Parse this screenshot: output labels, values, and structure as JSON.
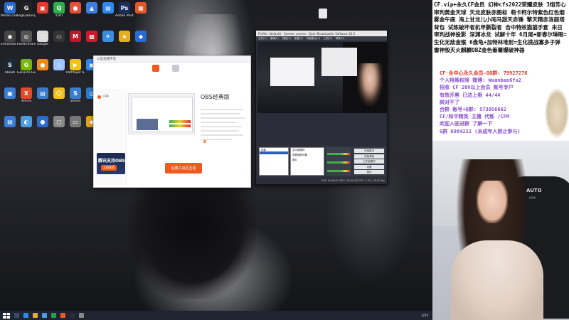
{
  "desktop": {
    "icons": [
      {
        "label": "Weibo.com maxiny...",
        "color": "#2a6ad1",
        "glyph": "W"
      },
      {
        "label": "LogiGaming Hub",
        "color": "#222222",
        "glyph": "G"
      },
      {
        "label": "",
        "color": "#e23b2a",
        "glyph": "▣"
      },
      {
        "label": "iQIYI",
        "color": "#2bb24c",
        "glyph": "Q"
      },
      {
        "label": "",
        "color": "#e94f3a",
        "glyph": "●"
      },
      {
        "label": "",
        "color": "#3b7de0",
        "glyph": "▲"
      },
      {
        "label": "",
        "color": "#2d89ef",
        "glyph": "▤"
      },
      {
        "label": "Adobe Photosho...",
        "color": "#1b2d5c",
        "glyph": "Ps"
      },
      {
        "label": "",
        "color": "#e0572a",
        "glyph": "▦"
      },
      {
        "label": "Elmanhar...",
        "color": "#444444",
        "glyph": "◉"
      },
      {
        "label": "PureEntrance",
        "color": "#555555",
        "glyph": "◎"
      },
      {
        "label": "Google",
        "color": "#dddddd",
        "glyph": "▢"
      },
      {
        "label": "",
        "color": "#333333",
        "glyph": "▭"
      },
      {
        "label": "",
        "color": "#c0182a",
        "glyph": "M"
      },
      {
        "label": "",
        "color": "#d0182a",
        "glyph": "▩"
      },
      {
        "label": "",
        "color": "#3a8de0",
        "glyph": "✈"
      },
      {
        "label": "",
        "color": "#e0b020",
        "glyph": "★"
      },
      {
        "label": "",
        "color": "#2a6ad1",
        "glyph": "◆"
      },
      {
        "label": "Steam",
        "color": "#1b2838",
        "glyph": "S"
      },
      {
        "label": "GeForce Experience",
        "color": "#76b900",
        "glyph": "G"
      },
      {
        "label": "",
        "color": "#ee8a1f",
        "glyph": "●"
      },
      {
        "label": "",
        "color": "#a0c4ff",
        "glyph": "◇"
      },
      {
        "label": "PotPlayer 64 bit",
        "color": "#f1c40f",
        "glyph": "▶"
      },
      {
        "label": "",
        "color": "#2d89ef",
        "glyph": "▣"
      },
      {
        "label": "",
        "color": "#1aa34a",
        "glyph": "◐"
      },
      {
        "label": "Pr",
        "color": "#2a1f5c",
        "glyph": "Pr"
      },
      {
        "label": "",
        "color": "#1aa34a",
        "glyph": "●"
      },
      {
        "label": "",
        "color": "#3a7dd0",
        "glyph": "▣"
      },
      {
        "label": "Xmind",
        "color": "#e24a2a",
        "glyph": "X"
      },
      {
        "label": "",
        "color": "#3a7dd0",
        "glyph": "▤"
      },
      {
        "label": "",
        "color": "#f0c020",
        "glyph": "☺"
      },
      {
        "label": "Steam",
        "color": "#3a7dd0",
        "glyph": "S"
      },
      {
        "label": "",
        "color": "#2a7ad0",
        "glyph": "◎"
      },
      {
        "label": "",
        "color": "#2a6ad1",
        "glyph": "▦"
      },
      {
        "label": "",
        "color": "#1aa34a",
        "glyph": "◉"
      },
      {
        "label": "",
        "color": "#e0b020",
        "glyph": "▣"
      },
      {
        "label": "",
        "color": "#3a7dd0",
        "glyph": "▤"
      },
      {
        "label": "",
        "color": "#4a9de0",
        "glyph": "◐"
      },
      {
        "label": "",
        "color": "#2a6ad1",
        "glyph": "●"
      },
      {
        "label": "",
        "color": "#888888",
        "glyph": "▢"
      },
      {
        "label": "",
        "color": "#777777",
        "glyph": "▭"
      },
      {
        "label": "",
        "color": "#e0a020",
        "glyph": "◆"
      },
      {
        "label": "",
        "color": "#2a6ad1",
        "glyph": "▣"
      }
    ]
  },
  "promo_window": {
    "title": "斗鱼直播伴侣",
    "tab1": "",
    "tab2": "",
    "side_item": "CFM",
    "banner_title": "腾讯支持OBS",
    "banner_btn": "立即体验",
    "obs_title": "OBS经典版",
    "obs_sub": "",
    "check1": "",
    "check2": "",
    "radio_label": "",
    "radio_opt": "",
    "cta_label": "设置工具区互动"
  },
  "obs_window": {
    "title": "Profile: (default) - Scenes: scenes - Open Broadcaster Software 25.0",
    "menu": [
      "文件(F)",
      "编辑(E)",
      "视图(V)",
      "配置(C)",
      "场景集合(S)",
      "工具(T)",
      "帮助(H)"
    ],
    "scenes_label": "场景",
    "sources": [
      "显示器捕获",
      "视频捕获设备",
      "图片"
    ],
    "controls": [
      "开始推流",
      "开始录制",
      "工作室模式",
      "设置",
      "退出"
    ],
    "status": "LIVE: 00:00:00   REC: 00:00:00   CPU: 2.4%, 30.00 fps"
  },
  "taskbar": {
    "tray_text": "1259"
  },
  "right_panel": {
    "top_text": "CF.vip+永久CF会员  幻神cfs2022荣耀皮肤 3炮芳心审判黄金天球 天龙皮肤赤图标 萌卡柯尔特紫色红色烟雾金午座  海上甘龙儿小闯马甜天赤锤 擎天精赤洛丽塔背包 试炼破坏者机甲撕裂者 击中特效猫猫手套 末日审判战神投影 深渊冰龙 试解十年 6月尾+新春尔琳眼=生化无敌金猴 6盘龟+加特林堆射=生化挑战寡多子弹 雷神毁灭火麒麟QBZ金色番薯爆破神器",
    "lines": [
      {
        "text": "CF·全中心永久会员-QQ群: 79927276",
        "color": "#e5352a"
      },
      {
        "text": "个人特殊权限 微博: Wuanbao6fu2",
        "color": "#8a4ed0"
      },
      {
        "text": "招收 CF 20V以上会员 账号专户",
        "color": "#8a4ed0"
      },
      {
        "text": "有效开黑 已达上限 44/44",
        "color": "#8a4ed0"
      },
      {
        "text": "斜对不了",
        "color": "#8a4ed0"
      },
      {
        "text": "合群 账号+Q群: 573956662",
        "color": "#8a4ed0"
      },
      {
        "text": "CF/和平精英 主播 代练 /CFM",
        "color": "#8a4ed0"
      },
      {
        "text": "欢迎入驻进群 了解一下",
        "color": "#8a4ed0"
      },
      {
        "text": "G群 6084222 (未成年人禁止参与)",
        "color": "#8a4ed0"
      }
    ],
    "chair_logo": "AUTO",
    "chair_sub": "CFM"
  }
}
